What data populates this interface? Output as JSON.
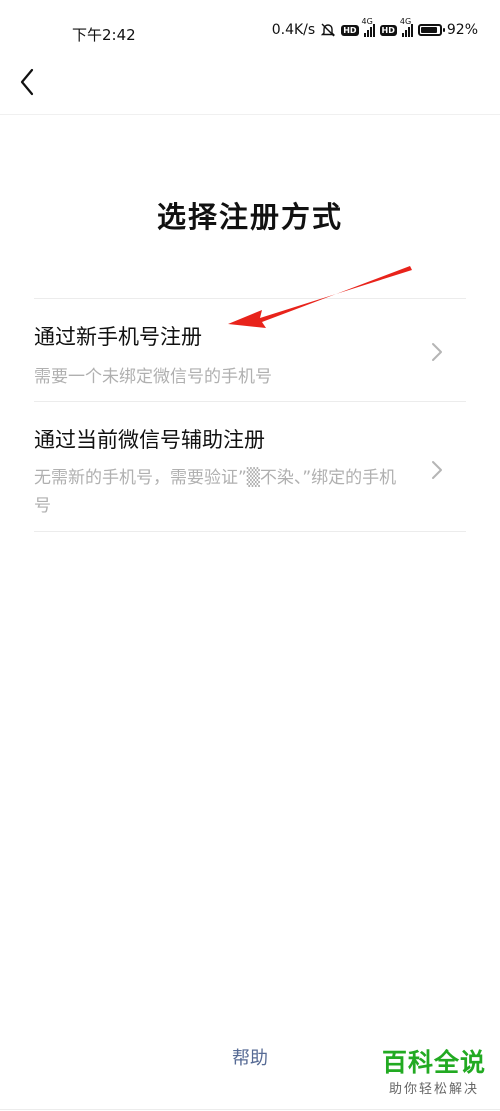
{
  "status_bar": {
    "time": "下午2:42",
    "net_speed": "0.4K/s",
    "hd_badge": "HD",
    "network_type": "4G",
    "battery": "92%",
    "battery_level": 0.92
  },
  "header": {
    "back_icon": "chevron-left-icon"
  },
  "page": {
    "title": "选择注册方式"
  },
  "options": [
    {
      "title": "通过新手机号注册",
      "desc": "需要一个未绑定微信号的手机号"
    },
    {
      "title": "通过当前微信号辅助注册",
      "desc": "无需新的手机号，需要验证”▒不染、”绑定的手机号"
    }
  ],
  "footer": {
    "help": "帮助"
  },
  "watermark": {
    "main": "百科全说",
    "sub": "助你轻松解决"
  },
  "colors": {
    "annotation_arrow": "#e8231b",
    "help_link": "#576b95",
    "watermark": "#22aa22"
  }
}
